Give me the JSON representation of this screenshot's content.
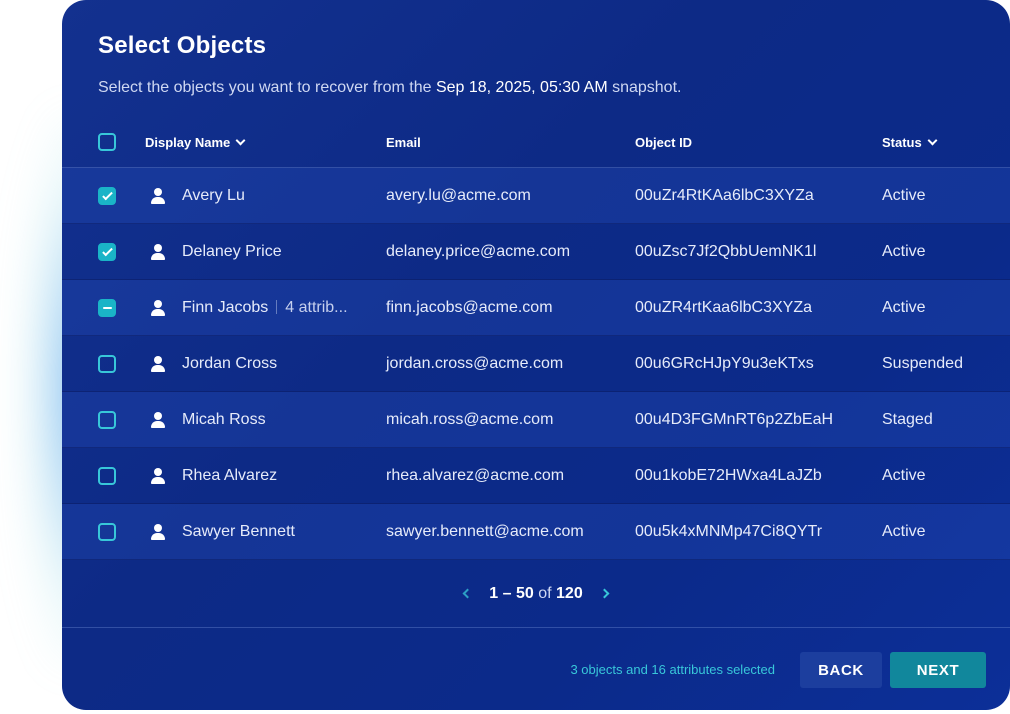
{
  "title": "Select Objects",
  "subtitle": {
    "prefix": "Select the objects you want to recover from the ",
    "snapshot_date": "Sep 18, 2025, 05:30 AM",
    "suffix": " snapshot."
  },
  "columns": {
    "display_name": "Display Name",
    "email": "Email",
    "object_id": "Object ID",
    "status": "Status"
  },
  "rows": [
    {
      "name": "Avery Lu",
      "attributes": "",
      "email": "avery.lu@acme.com",
      "object_id": "00uZr4RtKAa6lbC3XYZa",
      "status": "Active",
      "selection": "checked"
    },
    {
      "name": "Delaney Price",
      "attributes": "",
      "email": "delaney.price@acme.com",
      "object_id": "00uZsc7Jf2QbbUemNK1l",
      "status": "Active",
      "selection": "checked"
    },
    {
      "name": "Finn Jacobs",
      "attributes": "4 attrib...",
      "email": "finn.jacobs@acme.com",
      "object_id": "00uZR4rtKaa6lbC3XYZa",
      "status": "Active",
      "selection": "partial"
    },
    {
      "name": "Jordan Cross",
      "attributes": "",
      "email": "jordan.cross@acme.com",
      "object_id": "00u6GRcHJpY9u3eKTxs",
      "status": "Suspended",
      "selection": "none"
    },
    {
      "name": "Micah Ross",
      "attributes": "",
      "email": "micah.ross@acme.com",
      "object_id": "00u4D3FGMnRT6p2ZbEaH",
      "status": "Staged",
      "selection": "none"
    },
    {
      "name": "Rhea Alvarez",
      "attributes": "",
      "email": "rhea.alvarez@acme.com",
      "object_id": "00u1kobE72HWxa4LaJZb",
      "status": "Active",
      "selection": "none"
    },
    {
      "name": "Sawyer Bennett",
      "attributes": "",
      "email": "sawyer.bennett@acme.com",
      "object_id": "00u5k4xMNMp47Ci8QYTr",
      "status": "Active",
      "selection": "none"
    }
  ],
  "pagination": {
    "range": "1 – 50",
    "of_label": "of",
    "total": "120"
  },
  "footer": {
    "selection_summary": "3 objects and 16 attributes selected",
    "back_label": "BACK",
    "next_label": "NEXT"
  },
  "colors": {
    "panel_bg": "#0d2a86",
    "accent": "#1ab4c7",
    "next_button": "#11879c",
    "back_button": "#1c3e9e"
  },
  "icons": {
    "row_icon": "user-icon",
    "sort": "chevron-down-icon",
    "prev_page": "chevron-left-icon",
    "next_page": "chevron-right-icon"
  }
}
